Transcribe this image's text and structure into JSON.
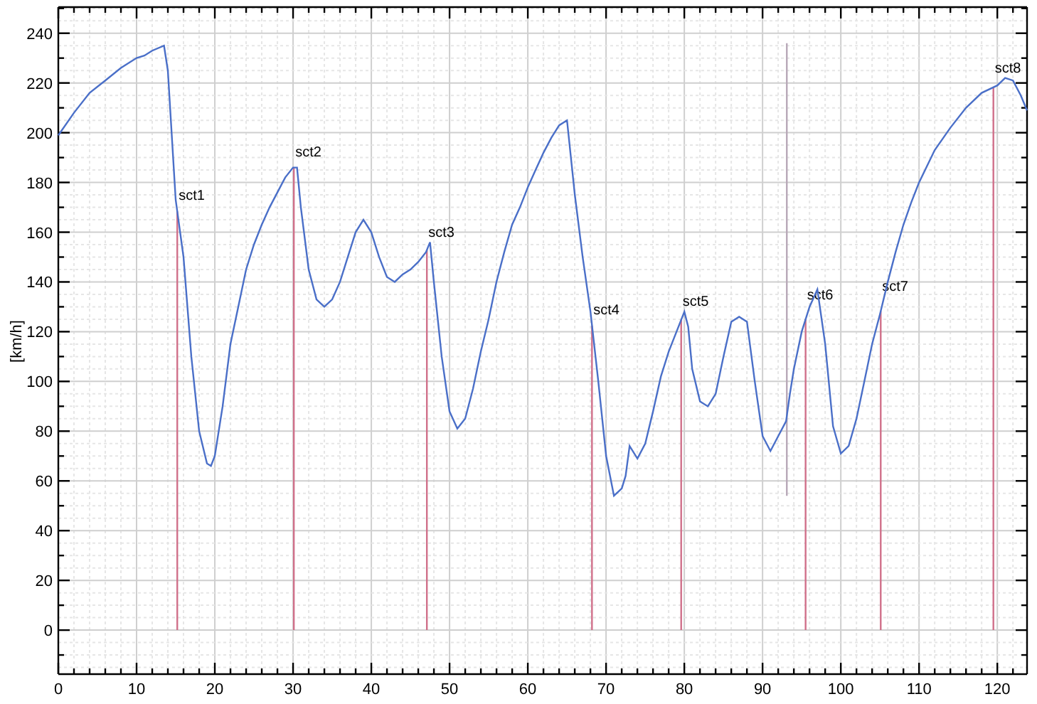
{
  "chart_data": {
    "type": "line",
    "ylabel": "[km/h]",
    "xlim": [
      0,
      123.8
    ],
    "ylim": [
      -17.7,
      250.5
    ],
    "xticks": [
      0,
      10,
      20,
      30,
      40,
      50,
      60,
      70,
      80,
      90,
      100,
      110,
      120
    ],
    "yticks": [
      0,
      20,
      40,
      60,
      80,
      100,
      120,
      140,
      160,
      180,
      200,
      220,
      240
    ],
    "x": [
      0,
      2,
      4,
      6,
      8,
      10,
      11,
      12,
      13.5,
      14,
      15,
      16,
      17,
      18,
      19,
      19.5,
      20,
      21,
      22,
      23,
      24,
      25,
      26,
      27,
      28,
      29,
      30,
      30.5,
      31,
      32,
      33,
      34,
      35,
      36,
      37,
      38,
      39,
      40,
      41,
      42,
      43,
      44,
      45,
      46,
      47,
      47.5,
      48,
      49,
      50,
      51,
      52,
      53,
      54,
      55,
      56,
      57,
      58,
      59,
      60,
      61,
      62,
      63,
      64,
      65,
      66,
      67,
      68,
      69,
      70,
      71,
      72,
      72.5,
      73,
      74,
      75,
      76,
      77,
      78,
      79,
      80,
      80.5,
      81,
      82,
      83,
      84,
      85,
      86,
      87,
      88,
      89,
      90,
      91,
      92,
      93,
      93.5,
      94,
      95,
      96,
      97,
      98,
      99,
      100,
      101,
      102,
      103,
      104,
      105,
      106,
      107,
      108,
      109,
      110,
      112,
      114,
      116,
      118,
      120,
      121,
      122,
      123,
      123.8
    ],
    "grid": true,
    "series": [
      {
        "color": "#4a6fc8",
        "values": [
          199,
          208,
          216,
          221,
          226,
          230,
          231,
          233,
          235,
          225,
          173,
          150,
          110,
          80,
          67,
          66,
          70,
          90,
          115,
          130,
          145,
          155,
          163,
          170,
          176,
          182,
          186,
          186,
          170,
          145,
          133,
          130,
          133,
          140,
          150,
          160,
          165,
          160,
          150,
          142,
          140,
          143,
          145,
          148,
          152,
          156,
          140,
          110,
          88,
          81,
          85,
          97,
          112,
          125,
          140,
          152,
          163,
          170,
          178,
          185,
          192,
          198,
          203,
          205,
          175,
          150,
          128,
          100,
          70,
          54,
          57,
          62,
          74,
          69,
          75,
          88,
          102,
          112,
          120,
          128,
          122,
          105,
          92,
          90,
          95,
          110,
          124,
          126,
          124,
          100,
          78,
          72,
          78,
          84,
          95,
          105,
          120,
          130,
          137,
          115,
          82,
          71,
          74,
          85,
          100,
          115,
          127,
          140,
          152,
          163,
          172,
          180,
          193,
          202,
          210,
          216,
          219,
          222,
          221,
          215,
          209
        ]
      }
    ],
    "ref_lines": [
      {
        "axis": "x",
        "value": 15.2,
        "label": "sct1",
        "color": "#d0708a"
      },
      {
        "axis": "x",
        "value": 30.1,
        "label": "sct2",
        "color": "#d0708a"
      },
      {
        "axis": "x",
        "value": 47.1,
        "label": "sct3",
        "color": "#d0708a"
      },
      {
        "axis": "x",
        "value": 68.2,
        "label": "sct4",
        "color": "#d0708a"
      },
      {
        "axis": "x",
        "value": 79.6,
        "label": "sct5",
        "color": "#d0708a"
      },
      {
        "axis": "x",
        "value": 93.1,
        "color": "#b8a8b8"
      },
      {
        "axis": "x",
        "value": 95.5,
        "label": "sct6",
        "color": "#d0708a"
      },
      {
        "axis": "x",
        "value": 105.1,
        "label": "sct7",
        "color": "#d0708a"
      },
      {
        "axis": "x",
        "value": 119.5,
        "label": "sct8",
        "color": "#d0708a"
      }
    ]
  }
}
